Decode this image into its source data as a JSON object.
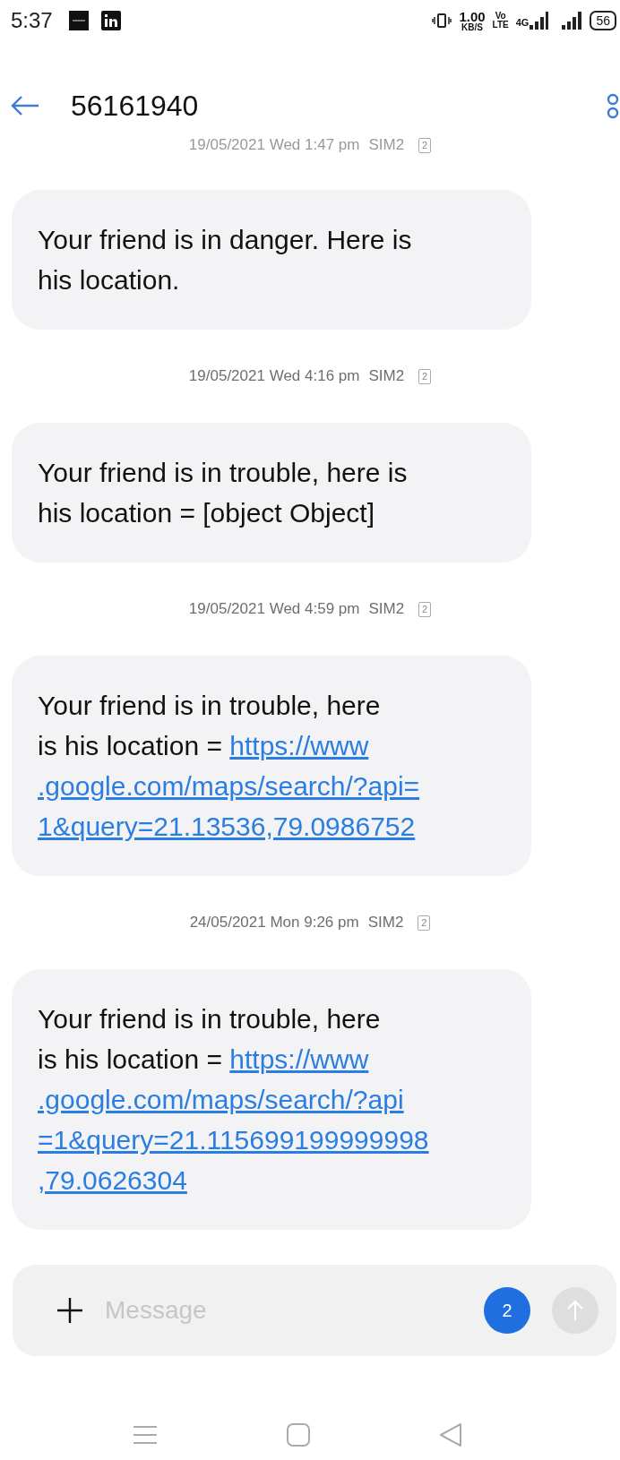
{
  "status_bar": {
    "time": "5:37",
    "speed": "1.00",
    "speed_unit": "KB/S",
    "volte": "Vo",
    "volte_sub": "LTE",
    "network": "4G",
    "battery": "56"
  },
  "header": {
    "title": "56161940"
  },
  "thread": [
    {
      "kind": "timestamp",
      "text": "19/05/2021 Wed 1:47 pm",
      "sim": "SIM2",
      "slot": "2"
    },
    {
      "kind": "message",
      "lines": [
        [
          {
            "kind": "text",
            "text": "Your friend is in danger. Here is"
          }
        ],
        [
          {
            "kind": "text",
            "text": "his location."
          }
        ]
      ]
    },
    {
      "kind": "timestamp",
      "text": "19/05/2021 Wed 4:16 pm",
      "sim": "SIM2",
      "slot": "2"
    },
    {
      "kind": "message",
      "lines": [
        [
          {
            "kind": "text",
            "text": "Your friend is in trouble, here is"
          }
        ],
        [
          {
            "kind": "text",
            "text": "his location = [object Object]"
          }
        ]
      ]
    },
    {
      "kind": "timestamp",
      "text": "19/05/2021 Wed 4:59 pm",
      "sim": "SIM2",
      "slot": "2"
    },
    {
      "kind": "message",
      "lines": [
        [
          {
            "kind": "text",
            "text": "Your friend is in trouble, here"
          }
        ],
        [
          {
            "kind": "text",
            "text": "is his location = "
          },
          {
            "kind": "link",
            "text": "https://www"
          }
        ],
        [
          {
            "kind": "link",
            "text": ".google.com/maps/search/?api="
          }
        ],
        [
          {
            "kind": "link",
            "text": "1&query=21.13536,79.0986752"
          }
        ]
      ]
    },
    {
      "kind": "timestamp",
      "text": "24/05/2021 Mon 9:26 pm",
      "sim": "SIM2",
      "slot": "2"
    },
    {
      "kind": "message",
      "lines": [
        [
          {
            "kind": "text",
            "text": "Your friend is in trouble, here"
          }
        ],
        [
          {
            "kind": "text",
            "text": "is his location = "
          },
          {
            "kind": "link",
            "text": "https://www"
          }
        ],
        [
          {
            "kind": "link",
            "text": ".google.com/maps/search/?api"
          }
        ],
        [
          {
            "kind": "link",
            "text": "=1&query=21.115699199999998"
          }
        ],
        [
          {
            "kind": "link",
            "text": ",79.0626304"
          }
        ]
      ]
    }
  ],
  "composer": {
    "placeholder": "Message",
    "sim_slot": "2"
  }
}
